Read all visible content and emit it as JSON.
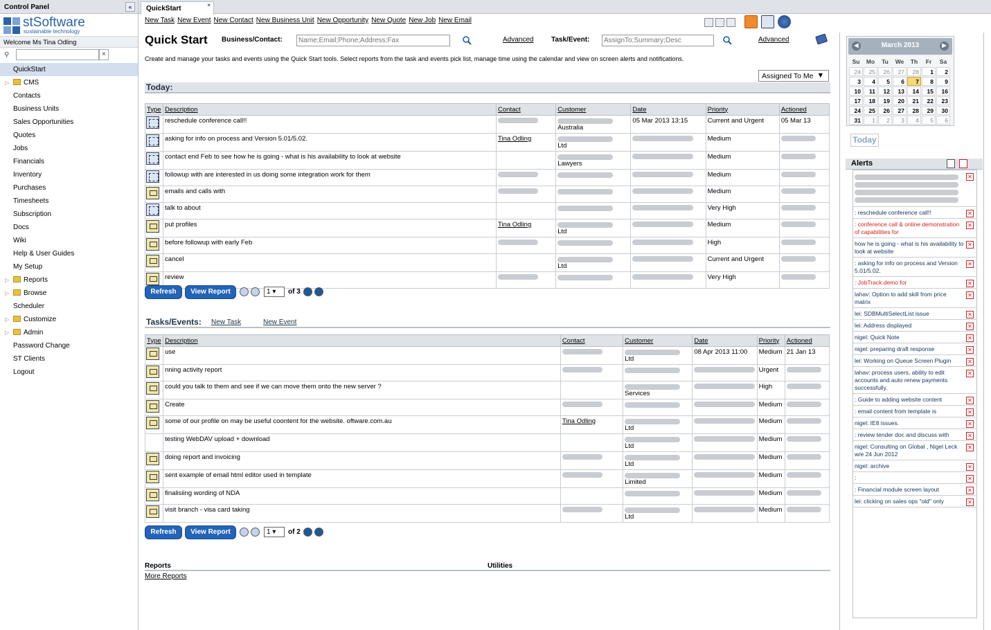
{
  "left": {
    "header": "Control Panel",
    "collapse_glyph": "«",
    "brand": "stSoftware",
    "tagline": "sustainable technology",
    "welcome": "Welcome Ms Tina Odling",
    "filter_clear_glyph": "×",
    "nav": [
      {
        "label": "QuickStart",
        "folder": false,
        "selected": true
      },
      {
        "label": "CMS",
        "folder": true
      },
      {
        "label": "Contacts",
        "folder": false
      },
      {
        "label": "Business Units",
        "folder": false
      },
      {
        "label": "Sales Opportunities",
        "folder": false
      },
      {
        "label": "Quotes",
        "folder": false
      },
      {
        "label": "Jobs",
        "folder": false
      },
      {
        "label": "Financials",
        "folder": false
      },
      {
        "label": "Inventory",
        "folder": false
      },
      {
        "label": "Purchases",
        "folder": false
      },
      {
        "label": "Timesheets",
        "folder": false
      },
      {
        "label": "Subscription",
        "folder": false
      },
      {
        "label": "Docs",
        "folder": false
      },
      {
        "label": "Wiki",
        "folder": false
      },
      {
        "label": "Help & User Guides",
        "folder": false
      },
      {
        "label": "My Setup",
        "folder": false
      },
      {
        "label": "Reports",
        "folder": true
      },
      {
        "label": "Browse",
        "folder": true
      },
      {
        "label": "Scheduler",
        "folder": false
      },
      {
        "label": "Customize",
        "folder": true
      },
      {
        "label": "Admin",
        "folder": true
      },
      {
        "label": "Password Change",
        "folder": false
      },
      {
        "label": "ST Clients",
        "folder": false
      },
      {
        "label": "Logout",
        "folder": false
      }
    ]
  },
  "tab": {
    "label": "QuickStart",
    "close": "×"
  },
  "toolbar": {
    "links": [
      "New Task",
      "New Event",
      "New Contact",
      "New Business Unit",
      "New Opportunity",
      "New Quote",
      "New Job",
      "New Email"
    ]
  },
  "quick": {
    "title": "Quick Start",
    "business_label": "Business/Contact:",
    "business_placeholder": "Name;Email;Phone;Address;Fax",
    "advanced": "Advanced",
    "task_label": "Task/Event:",
    "task_placeholder": "AssignTo;Summary;Desc",
    "description": "Create and manage your tasks and events using the Quick Start tools. Select reports from the task and events pick list, manage time using the calendar and view on screen alerts and notifications.",
    "assigned": "Assigned To Me",
    "assigned_arrow": "▼"
  },
  "today": {
    "header": "Today:",
    "columns": [
      "Type",
      "Description",
      "Contact",
      "Customer",
      "Date",
      "Priority",
      "Actioned"
    ],
    "rows": [
      {
        "type": "event",
        "desc": "reschedule conference call!!",
        "contact": "",
        "customer": "Australia",
        "date": "05 Mar 2013 13:15",
        "priority": "Current and Urgent",
        "actioned": "05 Mar 13"
      },
      {
        "type": "event",
        "desc": "asking for info on  process and  Version 5.01/5.02.",
        "contact": "Tina Odling",
        "customer": "Ltd",
        "date": "",
        "priority": "Medium",
        "actioned": ""
      },
      {
        "type": "event",
        "desc": "contact  end Feb to see how he is going - what is his availability to look at website",
        "contact": "",
        "customer": "Lawyers",
        "date": "",
        "priority": "Medium",
        "actioned": ""
      },
      {
        "type": "event",
        "desc": "followup with  are interested in us doing some integration work for them",
        "contact": "",
        "customer": "",
        "date": "",
        "priority": "Medium",
        "actioned": ""
      },
      {
        "type": "task",
        "desc": "emails and calls with",
        "contact": "",
        "customer": "",
        "date": "",
        "priority": "Medium",
        "actioned": ""
      },
      {
        "type": "event",
        "desc": "talk to  about",
        "contact": "",
        "customer": "",
        "date": "",
        "priority": "Very High",
        "actioned": ""
      },
      {
        "type": "task",
        "desc": "put  profiles",
        "contact": "Tina Odling",
        "customer": "Ltd",
        "date": "",
        "priority": "Medium",
        "actioned": ""
      },
      {
        "type": "task",
        "desc": "before followup with  early Feb",
        "contact": "",
        "customer": "",
        "date": "",
        "priority": "High",
        "actioned": ""
      },
      {
        "type": "task",
        "desc": "cancel",
        "contact": "",
        "customer": "Ltd",
        "date": "",
        "priority": "Current and Urgent",
        "actioned": ""
      },
      {
        "type": "task",
        "desc": "review",
        "contact": "",
        "customer": "",
        "date": "",
        "priority": "Very High",
        "actioned": ""
      }
    ],
    "pager": {
      "refresh": "Refresh",
      "view": "View Report",
      "page": "1",
      "of": "of 3"
    }
  },
  "tasks": {
    "header": "Tasks/Events:",
    "new_task": "New Task",
    "new_event": "New Event",
    "columns": [
      "Type",
      "Description",
      "Contact",
      "Customer",
      "Date",
      "Priority",
      "Actioned"
    ],
    "rows": [
      {
        "type": "task",
        "desc": "use",
        "contact": "",
        "customer": "Ltd",
        "date": "08 Apr 2013 11:00",
        "priority": "Medium",
        "actioned": "21 Jan 13"
      },
      {
        "type": "task",
        "desc": "nning activity report",
        "contact": "",
        "customer": "",
        "date": "",
        "priority": "Urgent",
        "actioned": ""
      },
      {
        "type": "task",
        "desc": "could you talk to them and see if we can move them onto the new server ?",
        "contact": "",
        "customer": "Services",
        "date": "",
        "priority": "High",
        "actioned": ""
      },
      {
        "type": "task",
        "desc": "Create",
        "contact": "",
        "customer": "",
        "date": "",
        "priority": "Medium",
        "actioned": ""
      },
      {
        "type": "task",
        "desc": "some of our profile on  may be useful coontent for the website.  oftware.com.au",
        "contact": "Tina Odling",
        "customer": "Ltd",
        "date": "",
        "priority": "Medium",
        "actioned": ""
      },
      {
        "type": "none",
        "desc": "testing WebDAV upload + download",
        "contact": "",
        "customer": "Ltd",
        "date": "",
        "priority": "Medium",
        "actioned": ""
      },
      {
        "type": "task",
        "desc": "doing  report and invoicing",
        "contact": "",
        "customer": "Ltd",
        "date": "",
        "priority": "Medium",
        "actioned": ""
      },
      {
        "type": "task",
        "desc": "sent example of email html editor used in template",
        "contact": "",
        "customer": "Limited",
        "date": "",
        "priority": "Medium",
        "actioned": ""
      },
      {
        "type": "task",
        "desc": "finalisiing wording of NDA",
        "contact": "",
        "customer": "",
        "date": "",
        "priority": "Medium",
        "actioned": ""
      },
      {
        "type": "task",
        "desc": "visit  branch - visa card taking",
        "contact": "",
        "customer": "Ltd",
        "date": "",
        "priority": "Medium",
        "actioned": ""
      }
    ],
    "pager": {
      "refresh": "Refresh",
      "view": "View Report",
      "page": "1",
      "of": "of 2"
    }
  },
  "bottom": {
    "reports": "Reports",
    "utilities": "Utilities",
    "more_reports": "More Reports"
  },
  "calendar": {
    "month": "March 2013",
    "prev": "◀",
    "next": "▶",
    "days": [
      "Su",
      "Mo",
      "Tu",
      "We",
      "Th",
      "Fr",
      "Sa"
    ],
    "weeks": [
      [
        "24",
        "25",
        "26",
        "27",
        "28",
        "1",
        "2"
      ],
      [
        "3",
        "4",
        "5",
        "6",
        "7",
        "8",
        "9"
      ],
      [
        "10",
        "11",
        "12",
        "13",
        "14",
        "15",
        "16"
      ],
      [
        "17",
        "18",
        "19",
        "20",
        "21",
        "22",
        "23"
      ],
      [
        "24",
        "25",
        "26",
        "27",
        "28",
        "29",
        "30"
      ],
      [
        "31",
        "1",
        "2",
        "3",
        "4",
        "5",
        "6"
      ]
    ],
    "today_label": "Today",
    "today_day": "7"
  },
  "alerts": {
    "header": "Alerts",
    "items": [
      {
        "text": "",
        "red": false,
        "lines": 4
      },
      {
        "text": ": reschedule conference call!!",
        "red": false
      },
      {
        "text": ": conference call & online demonstration of capabilities for",
        "red": true
      },
      {
        "text": "how he is going - what is his availability to look at website",
        "red": false
      },
      {
        "text": ": asking for info on  process and  Version 5.01/5.02.",
        "red": false
      },
      {
        "text": ": JobTrack.demo for",
        "red": true
      },
      {
        "text": "lahav: Option to add skill from price matrix",
        "red": false
      },
      {
        "text": "lei: SDBMultiSelectList issue",
        "red": false
      },
      {
        "text": "lei: Address displayed",
        "red": false
      },
      {
        "text": "nigel: Quick Note",
        "red": false
      },
      {
        "text": "nigel: preparing draft response",
        "red": false
      },
      {
        "text": "lei: Working on Queue Screen Plugin",
        "red": false
      },
      {
        "text": "lahav: process  users, ability to edit accounts and auto renew payments  successfully.",
        "red": false
      },
      {
        "text": ": Guide to adding website content",
        "red": false
      },
      {
        "text": ": email content from template is",
        "red": false
      },
      {
        "text": "nigel: IE8 issues.",
        "red": false
      },
      {
        "text": ": review tender doc and discuss with",
        "red": false
      },
      {
        "text": "nigel: Consulting on  Global , Nigel Leck w/e 24 Jun 2012",
        "red": false
      },
      {
        "text": "nigel: archive",
        "red": false
      },
      {
        "text": ":",
        "red": false
      },
      {
        "text": ": Financial module screen layout",
        "red": false
      },
      {
        "text": "lei: clicking on sales ops \"old\" only",
        "red": false
      }
    ]
  },
  "colors": {
    "accent": "#2364b9",
    "header_bg": "#dfe3e8",
    "alert_red": "#d42020",
    "today_cell": "#f8d878"
  }
}
